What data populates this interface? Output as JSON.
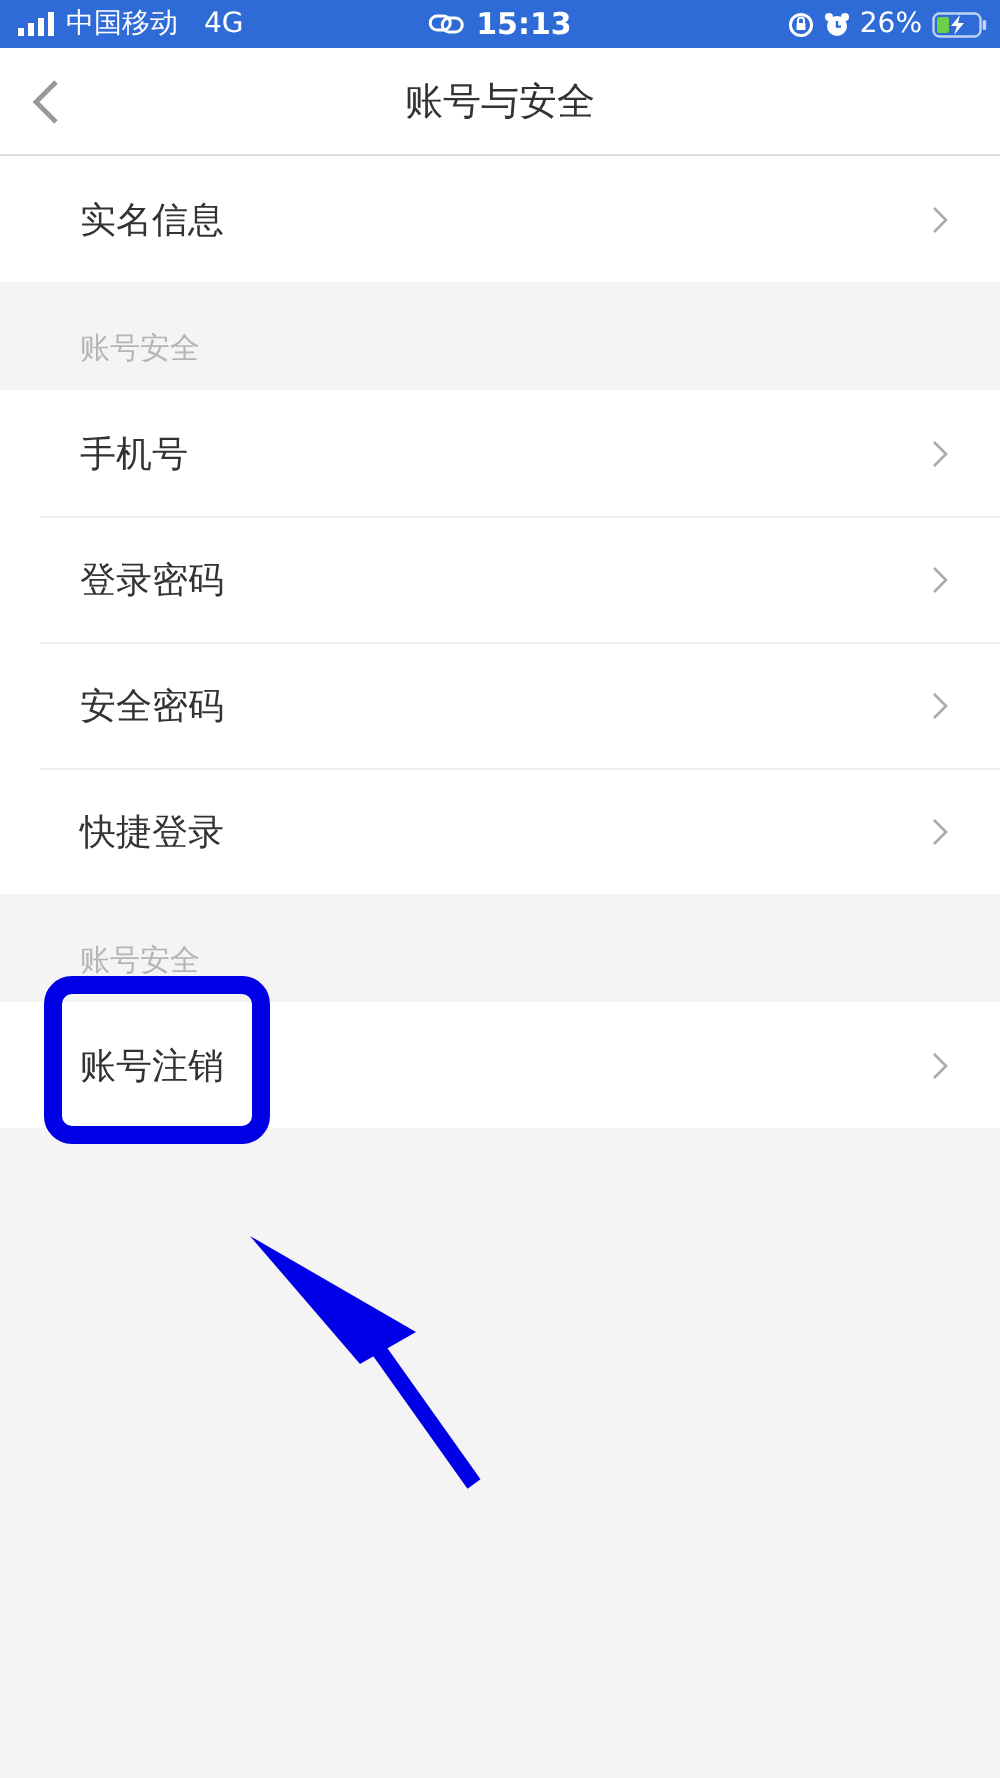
{
  "status_bar": {
    "carrier": "中国移动",
    "network": "4G",
    "time": "15:13",
    "battery": "26%"
  },
  "nav": {
    "title": "账号与安全"
  },
  "sections": [
    {
      "items": [
        {
          "label": "实名信息"
        }
      ]
    },
    {
      "header": "账号安全",
      "items": [
        {
          "label": "手机号"
        },
        {
          "label": "登录密码"
        },
        {
          "label": "安全密码"
        },
        {
          "label": "快捷登录"
        }
      ]
    },
    {
      "header": "账号安全",
      "items": [
        {
          "label": "账号注销"
        }
      ]
    }
  ]
}
